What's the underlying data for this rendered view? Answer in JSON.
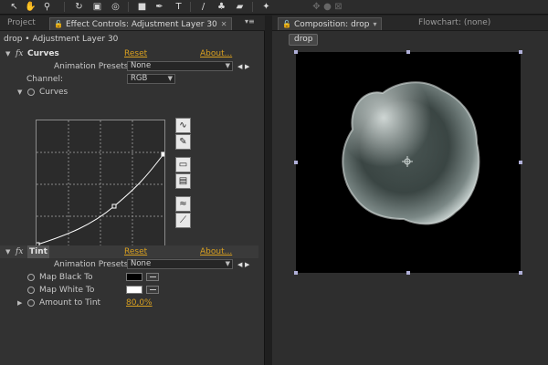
{
  "toolbar": {
    "icons": [
      "selection-tool-icon",
      "hand-tool-icon",
      "zoom-tool-icon",
      "rotate-tool-icon",
      "camera-tool-icon",
      "pan-behind-tool-icon",
      "rectangle-tool-icon",
      "pen-tool-icon",
      "type-tool-icon",
      "brush-tool-icon",
      "clone-stamp-tool-icon",
      "eraser-tool-icon",
      "puppet-tool-icon"
    ]
  },
  "left_panel": {
    "tabs": [
      {
        "label": "Project"
      },
      {
        "label": "Effect Controls: Adjustment Layer 30"
      }
    ],
    "breadcrumb": "drop • Adjustment Layer 30",
    "effects": {
      "curves": {
        "name": "Curves",
        "reset": "Reset",
        "about": "About...",
        "animation_presets_label": "Animation Presets:",
        "animation_presets_value": "None",
        "channel_label": "Channel:",
        "channel_value": "RGB",
        "property_label": "Curves"
      },
      "tint": {
        "name": "Tint",
        "reset": "Reset",
        "about": "About...",
        "animation_presets_label": "Animation Presets:",
        "animation_presets_value": "None",
        "map_black_label": "Map Black To",
        "map_black_color": "#000000",
        "map_white_label": "Map White To",
        "map_white_color": "#ffffff",
        "amount_label": "Amount to Tint",
        "amount_value": "80,0%"
      }
    }
  },
  "right_panel": {
    "tabs": [
      {
        "label": "Composition: drop"
      },
      {
        "label": "Flowchart: (none)"
      }
    ],
    "subtab": "drop"
  },
  "colors": {
    "link": "#d9a020",
    "panel_bg": "#323232",
    "comp_bg": "#000000",
    "handle": "#b0b0d8"
  }
}
